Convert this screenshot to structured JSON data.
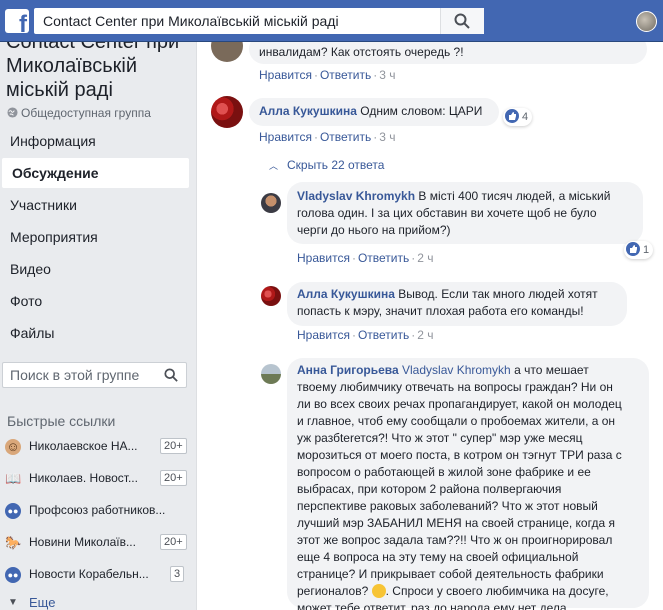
{
  "topbar": {
    "logo_letter": "f",
    "search_value": "Contact Center при Миколаївській міській раді",
    "brand_color": "#4267b2"
  },
  "sidebar": {
    "group_title_line1": "Contact Center при",
    "group_title_line2": "Миколаївській",
    "group_title_line3": "міській раді",
    "group_type": "Общедоступная группа",
    "nav": [
      {
        "label": "Информация"
      },
      {
        "label": "Обсуждение"
      },
      {
        "label": "Участники"
      },
      {
        "label": "Мероприятия"
      },
      {
        "label": "Видео"
      },
      {
        "label": "Фото"
      },
      {
        "label": "Файлы"
      }
    ],
    "search_placeholder": "Поиск в этой группе",
    "quick_links_header": "Быстрые ссылки",
    "quick_links": [
      {
        "label": "Николаевское НА...",
        "count": "20+",
        "icon": "group-avatar-icon"
      },
      {
        "label": "Николаев. Новост...",
        "count": "20+",
        "icon": "book-icon"
      },
      {
        "label": "Профсоюз работников...",
        "count": "",
        "icon": "group-icon"
      },
      {
        "label": "Новини Миколаїв...",
        "count": "20+",
        "icon": "horse-icon"
      },
      {
        "label": "Новости Корабельн...",
        "count": "3",
        "icon": "group-icon"
      }
    ],
    "more_label": "Еще"
  },
  "comments": [
    {
      "author": "",
      "text": "инвалидам? Как отстоять очередь ?!",
      "like_label": "Нравится",
      "reply_label": "Ответить",
      "time": "3 ч"
    },
    {
      "author": "Алла Кукушкина",
      "text": "Одним словом: ЦАРИ",
      "like_label": "Нравится",
      "reply_label": "Ответить",
      "time": "3 ч",
      "reactions": "4"
    }
  ],
  "hide_replies_label": "Скрыть 22 ответа",
  "replies": [
    {
      "author": "Vladyslav Khromykh",
      "text": "В місті 400 тисяч людей, а міський голова один. І за цих обставин ви хочете щоб не було черги до нього на прийом?)",
      "line1": "В місті 400 тисяч людей, а міський",
      "line2": "голова один. І за цих обставин ви хочете щоб не було",
      "line3": "черги до нього на прийом?)",
      "like_label": "Нравится",
      "reply_label": "Ответить",
      "time": "2 ч",
      "reactions": "1"
    },
    {
      "author": "Алла Кукушкина",
      "line1": "Вывод. Если так много людей хотят",
      "line2": "попасть к мэру, значит плохая работа его команды!",
      "like_label": "Нравится",
      "reply_label": "Ответить",
      "time": "2 ч"
    },
    {
      "author": "Анна Григорьева",
      "mention": "Vladyslav Khromykh",
      "line1": "а что мешает",
      "lines": [
        "твоему любимчику отвечать на вопросы граждан? Ни он",
        "ли во всех своих речах пропагандирует, какой он молодец",
        "и главное, чтоб ему сообщали о пробоемах жители, а он",
        "уж разбterется?! Что ж этот \" супер\" мэр уже месяц",
        "морозиться от моего поста, в котром он тэгнут ТРИ раза с",
        "вопросом о работающей в жилой зоне фабрике и ее",
        "выбрасах, при котором 2 района полвергаючия",
        "перспективе раковых заболеваний? Что ж этот новый",
        "лучший мэр ЗАБАНИЛ МЕНЯ на своей странице, когда я",
        "этот же вопрос задала там??!! Что ж он проигнорировал",
        "еще 4 вопроса на эту тему на своей официальной",
        "странице? И прикрывает собой деятельность фабрики",
        "регионалов?"
      ],
      "tail": ". Спроси у своего любимчика на досуге,",
      "last_line": "может тебе ответит, раз до народа ему нет дела."
    }
  ],
  "colors": {
    "link": "#385898",
    "meta": "#90949c",
    "bubble": "#f2f3f5"
  }
}
